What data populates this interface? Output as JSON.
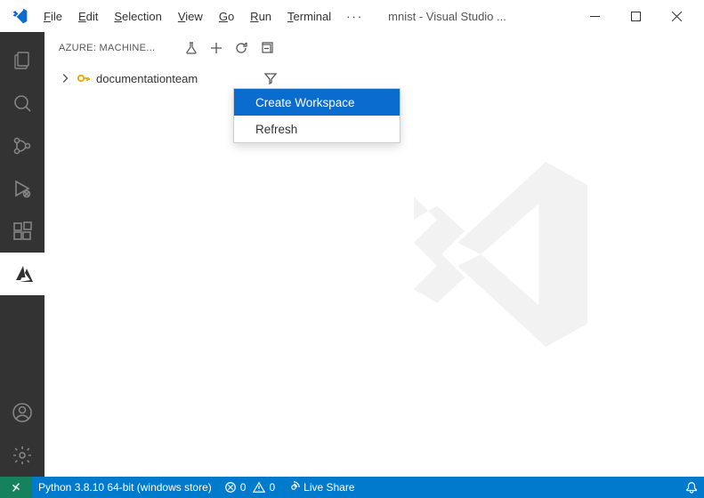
{
  "titlebar": {
    "menus": {
      "file": "File",
      "edit": "Edit",
      "selection": "Selection",
      "view": "View",
      "go": "Go",
      "run": "Run",
      "terminal": "Terminal"
    },
    "overflow": "···",
    "title": "mnist - Visual Studio ..."
  },
  "sidebar": {
    "title": "AZURE: MACHINE...",
    "tree": {
      "item_label": "documentationteam"
    }
  },
  "context_menu": {
    "create_workspace": "Create Workspace",
    "refresh": "Refresh"
  },
  "statusbar": {
    "python": "Python 3.8.10 64-bit (windows store)",
    "errors": "0",
    "warnings": "0",
    "live_share": "Live Share"
  }
}
